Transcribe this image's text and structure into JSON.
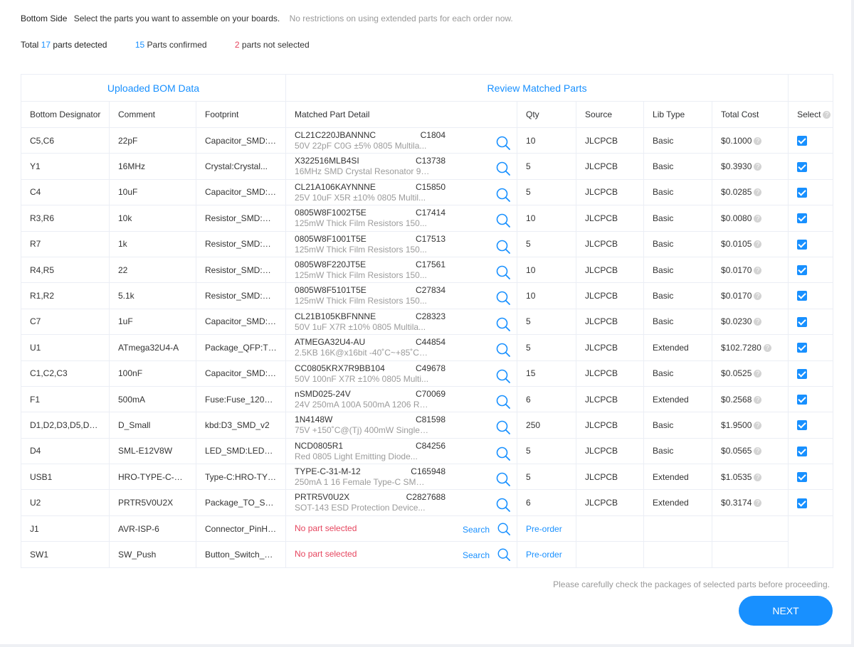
{
  "header": {
    "side": "Bottom Side",
    "instruction": "Select the parts you want to assemble on your boards.",
    "note": "No restrictions on using extended parts for each order now."
  },
  "stats": {
    "total_prefix": "Total",
    "total_count": "17",
    "total_suffix": "parts detected",
    "confirmed_count": "15",
    "confirmed_suffix": "Parts confirmed",
    "not_selected_count": "2",
    "not_selected_suffix": "parts not selected"
  },
  "table": {
    "group_left": "Uploaded BOM Data",
    "group_right": "Review Matched Parts",
    "columns": [
      "Bottom Designator",
      "Comment",
      "Footprint",
      "Matched Part Detail",
      "Qty",
      "Source",
      "Lib Type",
      "Total Cost",
      "Select"
    ],
    "rows": [
      {
        "designator": "C5,C6",
        "comment": "22pF",
        "footprint": "Capacitor_SMD:C...",
        "part": "CL21C220JBANNNC",
        "lcsc": "C1804",
        "desc": "50V 22pF C0G ±5% 0805 Multila...",
        "qty": "10",
        "source": "JLCPCB",
        "lib": "Basic",
        "cost": "$0.1000"
      },
      {
        "designator": "Y1",
        "comment": "16MHz",
        "footprint": "Crystal:Crystal...",
        "part": "X322516MLB4SI",
        "lcsc": "C13738",
        "desc": "16MHz SMD Crystal Resonator 9p...",
        "qty": "5",
        "source": "JLCPCB",
        "lib": "Basic",
        "cost": "$0.3930"
      },
      {
        "designator": "C4",
        "comment": "10uF",
        "footprint": "Capacitor_SMD:C...",
        "part": "CL21A106KAYNNNE",
        "lcsc": "C15850",
        "desc": "25V 10uF X5R ±10% 0805 Multil...",
        "qty": "5",
        "source": "JLCPCB",
        "lib": "Basic",
        "cost": "$0.0285"
      },
      {
        "designator": "R3,R6",
        "comment": "10k",
        "footprint": "Resistor_SMD:R_...",
        "part": "0805W8F1002T5E",
        "lcsc": "C17414",
        "desc": "125mW Thick Film Resistors 150...",
        "qty": "10",
        "source": "JLCPCB",
        "lib": "Basic",
        "cost": "$0.0080"
      },
      {
        "designator": "R7",
        "comment": "1k",
        "footprint": "Resistor_SMD:R_...",
        "part": "0805W8F1001T5E",
        "lcsc": "C17513",
        "desc": "125mW Thick Film Resistors 150...",
        "qty": "5",
        "source": "JLCPCB",
        "lib": "Basic",
        "cost": "$0.0105"
      },
      {
        "designator": "R4,R5",
        "comment": "22",
        "footprint": "Resistor_SMD:R_...",
        "part": "0805W8F220JT5E",
        "lcsc": "C17561",
        "desc": "125mW Thick Film Resistors 150...",
        "qty": "10",
        "source": "JLCPCB",
        "lib": "Basic",
        "cost": "$0.0170"
      },
      {
        "designator": "R1,R2",
        "comment": "5.1k",
        "footprint": "Resistor_SMD:R_...",
        "part": "0805W8F5101T5E",
        "lcsc": "C27834",
        "desc": "125mW Thick Film Resistors 150...",
        "qty": "10",
        "source": "JLCPCB",
        "lib": "Basic",
        "cost": "$0.0170"
      },
      {
        "designator": "C7",
        "comment": "1uF",
        "footprint": "Capacitor_SMD:C...",
        "part": "CL21B105KBFNNNE",
        "lcsc": "C28323",
        "desc": "50V 1uF X7R ±10% 0805 Multila...",
        "qty": "5",
        "source": "JLCPCB",
        "lib": "Basic",
        "cost": "$0.0230"
      },
      {
        "designator": "U1",
        "comment": "ATmega32U4-A",
        "footprint": "Package_QFP:TQF...",
        "part": "ATMEGA32U4-AU",
        "lcsc": "C44854",
        "desc": "2.5KB 16K@x16bit -40˚C~+85˚C 2.7...",
        "qty": "5",
        "source": "JLCPCB",
        "lib": "Extended",
        "cost": "$102.7280"
      },
      {
        "designator": "C1,C2,C3",
        "comment": "100nF",
        "footprint": "Capacitor_SMD:C...",
        "part": "CC0805KRX7R9BB104",
        "lcsc": "C49678",
        "desc": "50V 100nF X7R ±10% 0805 Multi...",
        "qty": "15",
        "source": "JLCPCB",
        "lib": "Basic",
        "cost": "$0.0525"
      },
      {
        "designator": "F1",
        "comment": "500mA",
        "footprint": "Fuse:Fuse_1206_...",
        "part": "nSMD025-24V",
        "lcsc": "C70069",
        "desc": "24V 250mA 100A 500mA 1206 Res...",
        "qty": "6",
        "source": "JLCPCB",
        "lib": "Extended",
        "cost": "$0.2568"
      },
      {
        "designator": "D1,D2,D3,D5,D6,...",
        "comment": "D_Small",
        "footprint": "kbd:D3_SMD_v2",
        "part": "1N4148W",
        "lcsc": "C81598",
        "desc": "75V +150˚C@(Tj) 400mW Single 1....",
        "qty": "250",
        "source": "JLCPCB",
        "lib": "Basic",
        "cost": "$1.9500"
      },
      {
        "designator": "D4",
        "comment": "SML-E12V8W",
        "footprint": "LED_SMD:LED_080...",
        "part": "NCD0805R1",
        "lcsc": "C84256",
        "desc": "Red 0805 Light Emitting Diode...",
        "qty": "5",
        "source": "JLCPCB",
        "lib": "Basic",
        "cost": "$0.0565"
      },
      {
        "designator": "USB1",
        "comment": "HRO-TYPE-C-31-M...",
        "footprint": "Type-C:HRO-TYPE...",
        "part": "TYPE-C-31-M-12",
        "lcsc": "C165948",
        "desc": "250mA 1 16 Female Type-C SMD ...",
        "qty": "5",
        "source": "JLCPCB",
        "lib": "Extended",
        "cost": "$1.0535"
      },
      {
        "designator": "U2",
        "comment": "PRTR5V0U2X",
        "footprint": "Package_TO_SOT_...",
        "part": "PRTR5V0U2X",
        "lcsc": "C2827688",
        "desc": "SOT-143 ESD Protection Device...",
        "qty": "6",
        "source": "JLCPCB",
        "lib": "Extended",
        "cost": "$0.3174"
      }
    ],
    "unmatched": [
      {
        "designator": "J1",
        "comment": "AVR-ISP-6",
        "footprint": "Connector_PinHe...",
        "status": "No part selected",
        "search": "Search",
        "qty": "Pre-order"
      },
      {
        "designator": "SW1",
        "comment": "SW_Push",
        "footprint": "Button_Switch_S...",
        "status": "No part selected",
        "search": "Search",
        "qty": "Pre-order"
      }
    ]
  },
  "footer": {
    "note": "Please carefully check the packages of selected parts before proceeding.",
    "next_label": "NEXT"
  },
  "colors": {
    "accent": "#1890ff",
    "danger": "#e6455e"
  }
}
